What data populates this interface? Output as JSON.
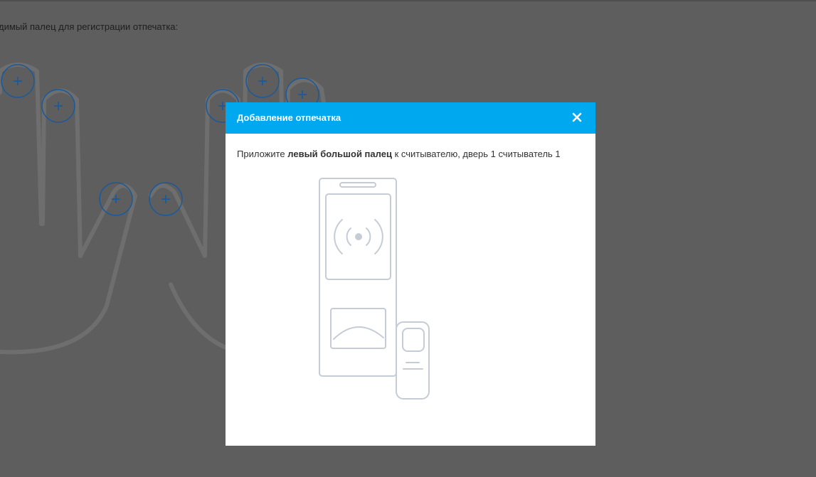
{
  "background": {
    "instruction": "димый палец для регистрации отпечатка:",
    "finger_add_symbol": "+"
  },
  "modal": {
    "title": "Добавление отпечатка",
    "close_icon": "close-icon",
    "message_prefix": "Приложите ",
    "message_finger": "левый большой палец",
    "message_suffix": " к считывателю, дверь 1 считыватель 1"
  },
  "colors": {
    "header": "#00a8f0",
    "overlay": "#5e5e5e",
    "finger_button_stroke": "#1a5a9a",
    "illustration_stroke": "#c5ccd6"
  }
}
